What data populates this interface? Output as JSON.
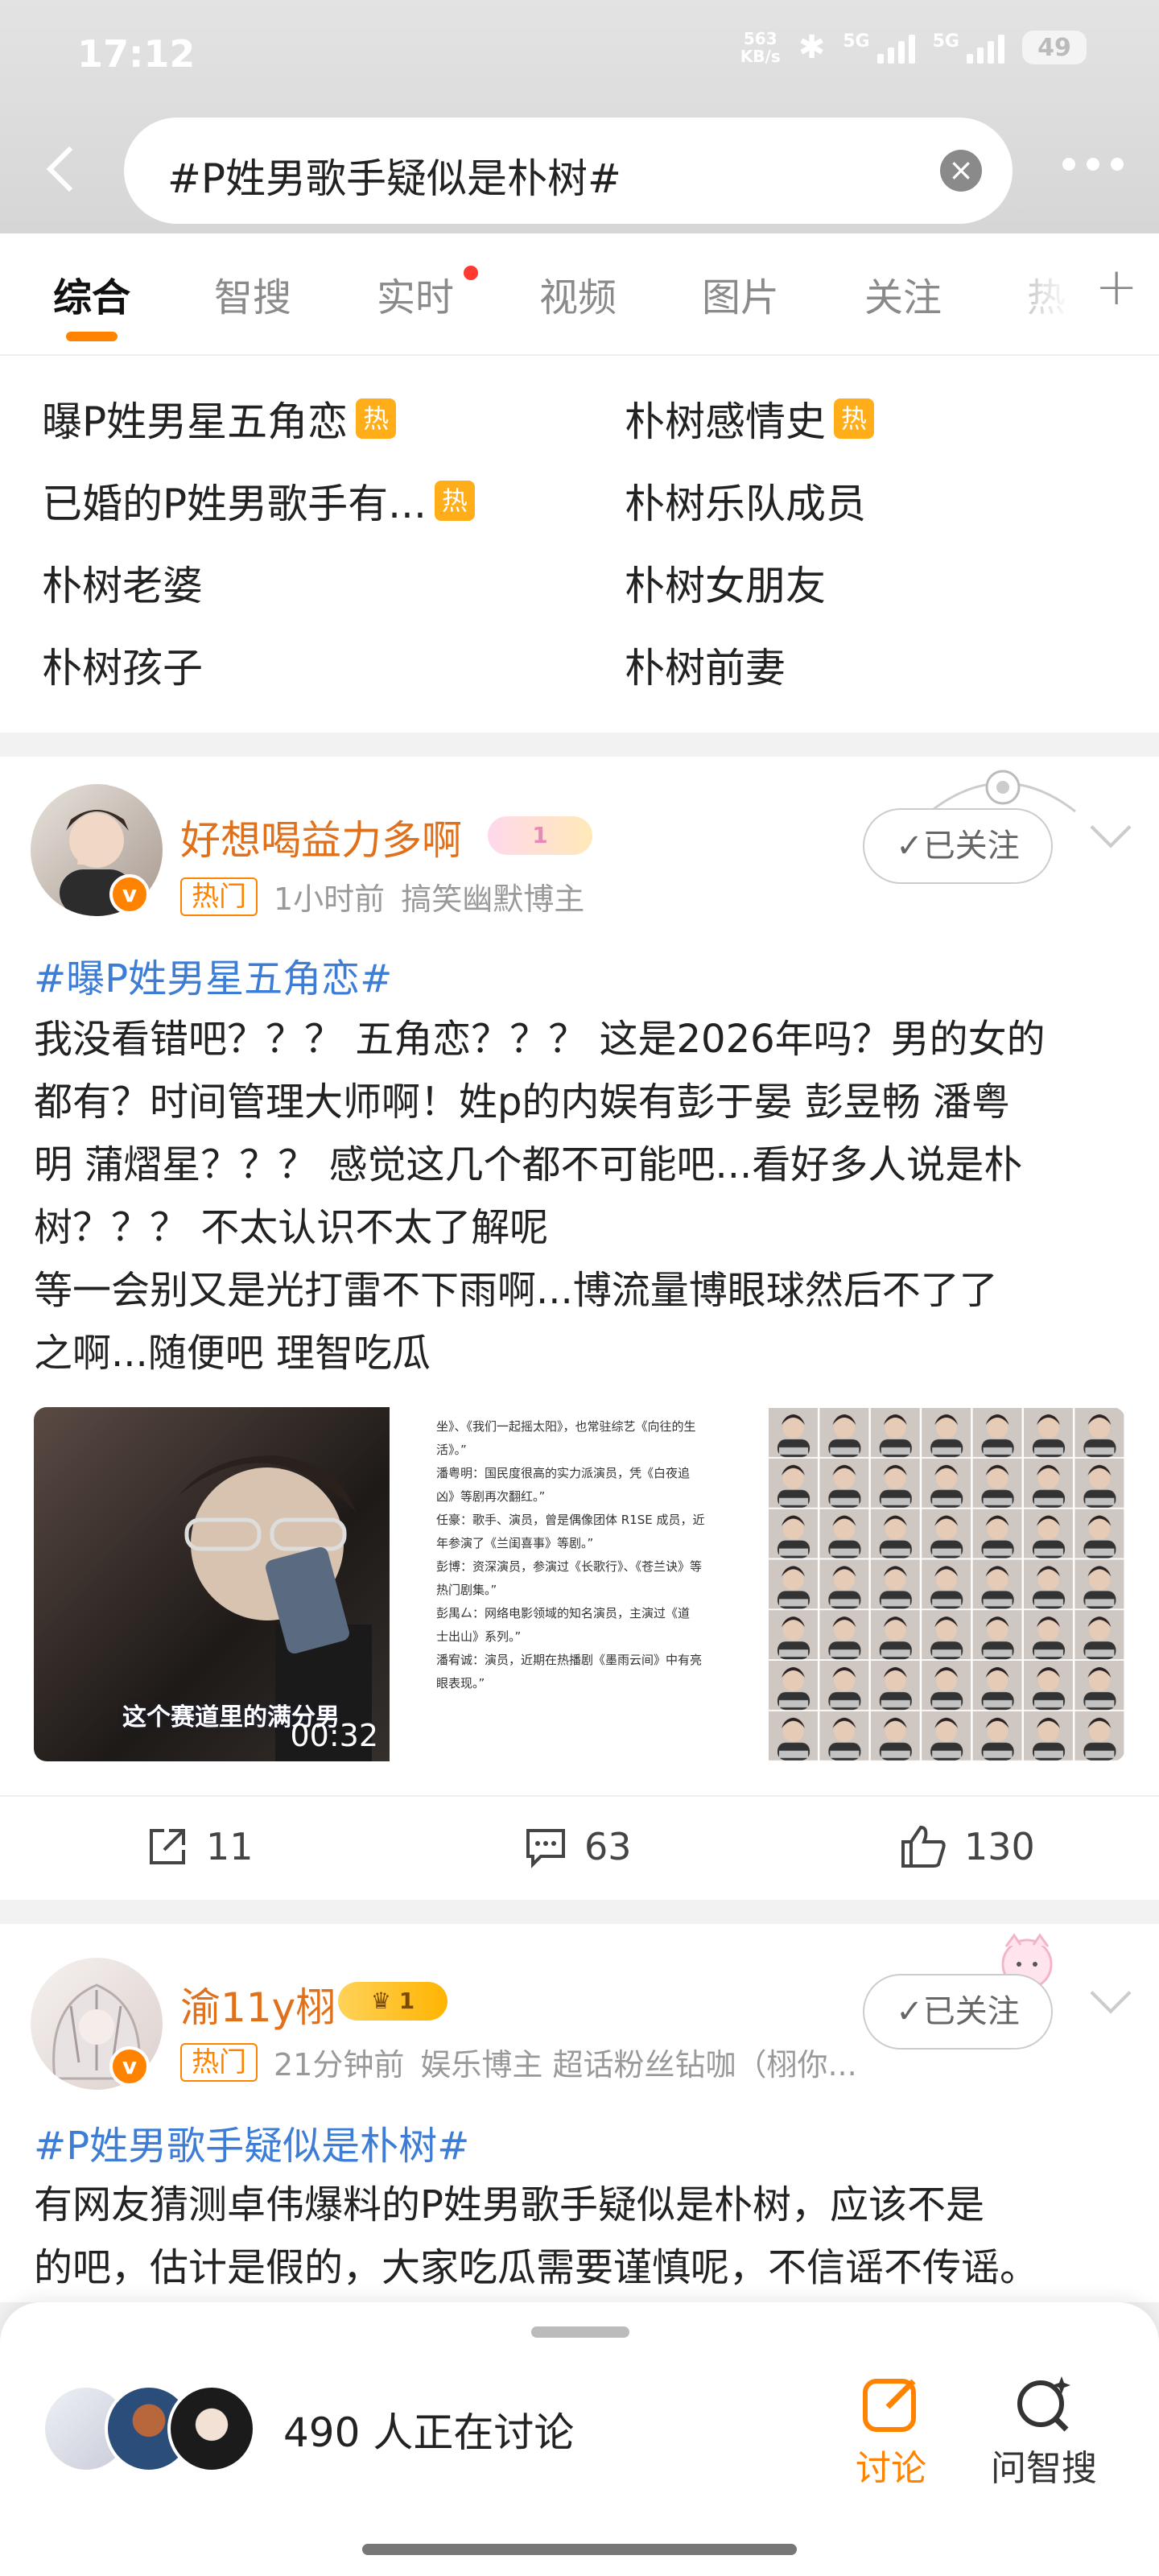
{
  "status": {
    "time": "17:12",
    "net_speed_value": "563",
    "net_speed_unit": "KB/s",
    "sig1_label": "5G",
    "sig2_label": "5G",
    "battery": "49"
  },
  "search": {
    "query": "#P姓男歌手疑似是朴树#"
  },
  "tabs": [
    {
      "label": "综合"
    },
    {
      "label": "智搜"
    },
    {
      "label": "实时"
    },
    {
      "label": "视频"
    },
    {
      "label": "图片"
    },
    {
      "label": "关注"
    },
    {
      "label": "热"
    }
  ],
  "related": {
    "items": [
      {
        "label": "曝P姓男星五角恋",
        "hot": "热"
      },
      {
        "label": "朴树感情史",
        "hot": "热"
      },
      {
        "label": "已婚的P姓男歌手有...",
        "hot": "热"
      },
      {
        "label": "朴树乐队成员"
      },
      {
        "label": "朴树老婆"
      },
      {
        "label": "朴树女朋友"
      },
      {
        "label": "朴树孩子"
      },
      {
        "label": "朴树前妻"
      }
    ]
  },
  "posts": [
    {
      "username": "好想喝益力多啊",
      "badge": "1",
      "hot_tag": "热门",
      "time": "1小时前",
      "role": "搞笑幽默博主",
      "follow_label": "✓已关注",
      "topic": "#曝P姓男星五角恋#",
      "body_lines": [
        "我没看错吧？？？ 五角恋？？？ 这是2026年吗？男的女的",
        "都有？时间管理大师啊！姓p的内娱有彭于晏 彭昱畅 潘粤",
        "明 蒲熠星？？？ 感觉这几个都不可能吧...看好多人说是朴",
        "树？？？ 不太认识不太了解呢",
        "等一会别又是光打雷不下雨啊...博流量博眼球然后不了了",
        "之啊...随便吧 理智吃瓜"
      ],
      "video_caption": "这个赛道里的满分男",
      "video_duration": "00:32",
      "doc_lines": [
        "坐》、《我们一起摇太阳》，也常驻综艺《向往的生",
        "活》。”",
        "潘粤明：国民度很高的实力派演员，凭《白夜追",
        "凶》等剧再次翻红。”",
        "任豪：歌手、演员，曾是偶像团体 R1SE 成员，近",
        "年参演了《兰闺喜事》等剧。”",
        "彭博：资深演员，参演过《长歌行》、《苍兰诀》等",
        "热门剧集。”",
        "彭禺厶：网络电影领域的知名演员，主演过《道",
        "士出山》系列。”",
        "潘宥诚：演员，近期在热播剧《墨雨云间》中有亮",
        "眼表现。”"
      ],
      "reposts": "11",
      "comments": "63",
      "likes": "130"
    },
    {
      "username": "渝11y栩",
      "badge": "1",
      "hot_tag": "热门",
      "time": "21分钟前",
      "role": "娱乐博主 超话粉丝钻咖（栩你...",
      "follow_label": "✓已关注",
      "topic": "#P姓男歌手疑似是朴树#",
      "body_lines": [
        "有网友猜测卓伟爆料的P姓男歌手疑似是朴树，应该不是",
        "的吧，估计是假的，大家吃瓜需要谨慎呢，不信谣不传谣。"
      ]
    }
  ],
  "bottom": {
    "discussing": "490 人正在讨论",
    "discuss_label": "讨论",
    "ask_label": "问智搜"
  },
  "colors": {
    "accent": "#ff8200",
    "topic": "#3e7dd6",
    "username": "#e0701a"
  }
}
